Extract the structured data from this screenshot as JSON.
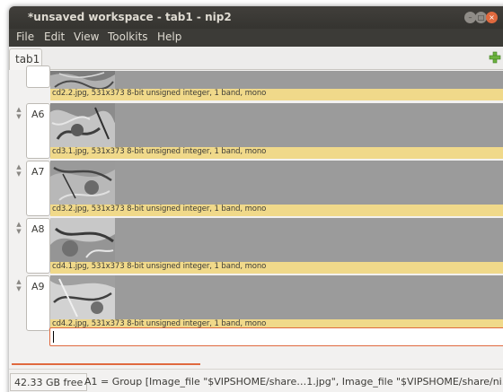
{
  "window": {
    "title": "*unsaved workspace - tab1 - nip2",
    "controls": {
      "minimize_icon": "minimize-icon",
      "maximize_icon": "maximize-icon",
      "close_icon": "close-icon"
    }
  },
  "menubar": {
    "items": [
      "File",
      "Edit",
      "View",
      "Toolkits",
      "Help"
    ]
  },
  "tabs": {
    "active": "tab1",
    "add_icon": "plus-icon"
  },
  "rows": [
    {
      "label": "",
      "info": "cd2.2.jpg, 531x373 8-bit unsigned integer, 1 band, mono"
    },
    {
      "label": "A6",
      "info": "cd3.1.jpg, 531x373 8-bit unsigned integer, 1 band, mono"
    },
    {
      "label": "A7",
      "info": "cd3.2.jpg, 531x373 8-bit unsigned integer, 1 band, mono"
    },
    {
      "label": "A8",
      "info": "cd4.1.jpg, 531x373 8-bit unsigned integer, 1 band, mono"
    },
    {
      "label": "A9",
      "info": "cd4.2.jpg, 531x373 8-bit unsigned integer, 1 band, mono"
    }
  ],
  "input": {
    "value": ""
  },
  "statusbar": {
    "free_space": "42.33 GB free",
    "text": "A1 = Group [Image_file \"$VIPSHOME/share…1.jpg\", Image_file \"$VIPSHOME/share/ni..."
  },
  "colors": {
    "accent": "#e0693e",
    "info_strip": "#f0d98a",
    "menubar": "#3c3b37"
  }
}
